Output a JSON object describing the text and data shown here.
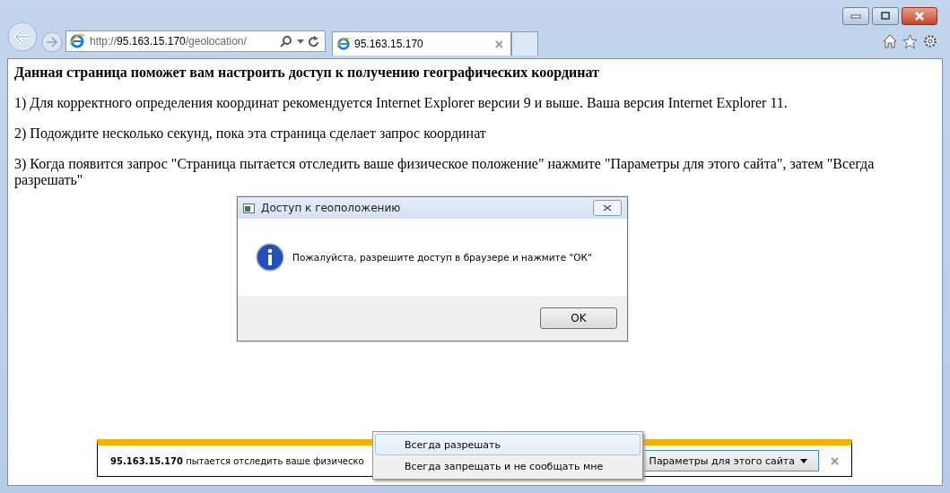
{
  "browser": {
    "address": {
      "scheme": "http://",
      "host": "95.163.15.170",
      "path": "/geolocation/"
    },
    "tabs": [
      {
        "label": "95.163.15.170",
        "selected": true
      }
    ]
  },
  "page": {
    "heading": "Данная страница поможет вам настроить доступ к получению географических координат",
    "paragraphs": [
      "1) Для корректного определения координат рекомендуется Internet Explorer версии 9 и выше. Ваша версия Internet Explorer 11.",
      "2) Подождите несколько секунд, пока эта страница сделает запрос координат",
      "3) Когда появится запрос \"Страница пытается отследить ваше физическое положение\" нажмите \"Параметры для этого сайта\", затем \"Всегда разрешать\""
    ]
  },
  "dialog": {
    "title": "Доступ к геоположению",
    "message": "Пожалуйста, разрешите доступ в браузере и нажмите \"ОК\"",
    "button": "OK"
  },
  "notification": {
    "text": "**95.163.15.170** пытается отследить ваше физическо",
    "button": "Параметры для этого сайта"
  },
  "menu": [
    {
      "label": "Всегда разрешать",
      "selected": true
    },
    {
      "label": "Всегда запрещать и не сообщать мне",
      "selected": false
    }
  ]
}
